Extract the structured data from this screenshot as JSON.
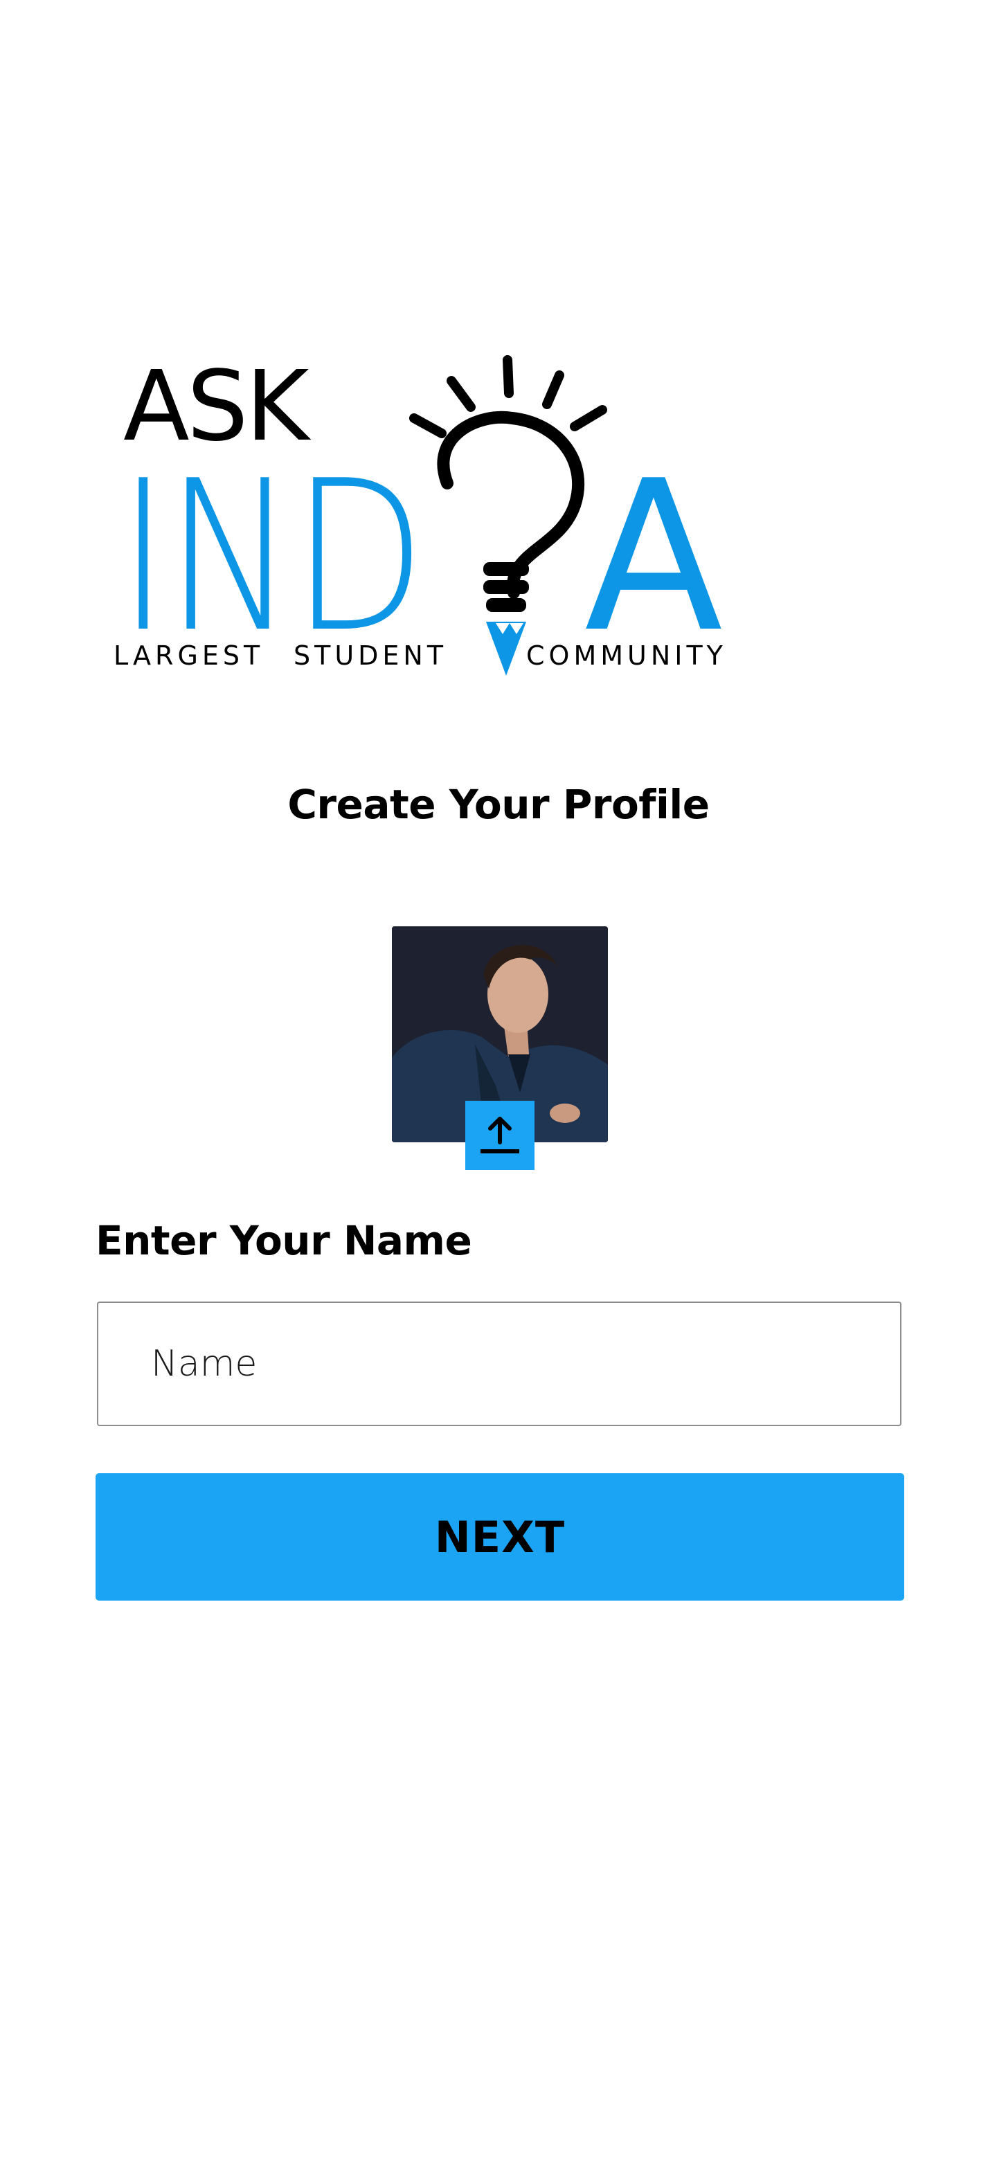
{
  "logo": {
    "line1": "ASK",
    "line2_left": "IND",
    "line2_right": "A",
    "tagline_1": "LARGEST",
    "tagline_2": "STUDENT",
    "tagline_3": "COMMUNITY",
    "icon": "lightbulb-question-icon",
    "brand_color": "#0d96e6"
  },
  "page": {
    "title": "Create Your Profile"
  },
  "profile": {
    "avatar_alt": "profile photo",
    "upload_icon": "upload-icon"
  },
  "form": {
    "name_label": "Enter Your Name",
    "name_placeholder": "Name",
    "name_value": "",
    "next_label": "NEXT"
  },
  "colors": {
    "accent": "#1ba4f3",
    "text": "#000000",
    "background": "#ffffff",
    "input_border": "#8d8d8d"
  }
}
